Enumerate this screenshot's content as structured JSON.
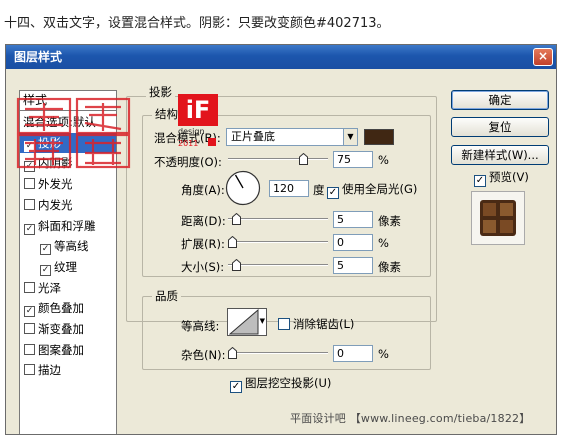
{
  "caption": "十四、双击文字，设置混合样式。阴影：只要改变颜色#402713。",
  "dialog": {
    "title": "图层样式",
    "close": "×"
  },
  "styles_panel": {
    "header": "样式",
    "items": [
      {
        "label": "混合选项:默认",
        "checked": null,
        "sub": false,
        "selected": false
      },
      {
        "label": "投影",
        "checked": true,
        "sub": false,
        "selected": true
      },
      {
        "label": "内阴影",
        "checked": true,
        "sub": false,
        "selected": false
      },
      {
        "label": "外发光",
        "checked": false,
        "sub": false,
        "selected": false
      },
      {
        "label": "内发光",
        "checked": false,
        "sub": false,
        "selected": false
      },
      {
        "label": "斜面和浮雕",
        "checked": true,
        "sub": false,
        "selected": false
      },
      {
        "label": "等高线",
        "checked": true,
        "sub": true,
        "selected": false
      },
      {
        "label": "纹理",
        "checked": true,
        "sub": true,
        "selected": false
      },
      {
        "label": "光泽",
        "checked": false,
        "sub": false,
        "selected": false
      },
      {
        "label": "颜色叠加",
        "checked": true,
        "sub": false,
        "selected": false
      },
      {
        "label": "渐变叠加",
        "checked": false,
        "sub": false,
        "selected": false
      },
      {
        "label": "图案叠加",
        "checked": false,
        "sub": false,
        "selected": false
      },
      {
        "label": "描边",
        "checked": false,
        "sub": false,
        "selected": false
      }
    ]
  },
  "drop_shadow": {
    "group_title": "投影",
    "structure_title": "结构",
    "blend_mode_label": "混合模式(B):",
    "blend_mode_value": "正片叠底",
    "shadow_color": "#402713",
    "opacity_label": "不透明度(O):",
    "opacity_value": "75",
    "opacity_unit": "%",
    "opacity_fraction": 0.75,
    "angle_label": "角度(A):",
    "angle_value": "120",
    "angle_unit": "度",
    "global_light_label": "使用全局光(G)",
    "global_light_checked": true,
    "distance_label": "距离(D):",
    "distance_value": "5",
    "distance_unit": "像素",
    "spread_label": "扩展(R):",
    "spread_value": "0",
    "spread_unit": "%",
    "size_label": "大小(S):",
    "size_value": "5",
    "size_unit": "像素"
  },
  "quality": {
    "group_title": "品质",
    "contour_label": "等高线:",
    "anti_alias_label": "消除锯齿(L)",
    "anti_alias_checked": false,
    "noise_label": "杂色(N):",
    "noise_value": "0",
    "noise_unit": "%",
    "knockout_label": "图层挖空投影(U)",
    "knockout_checked": true
  },
  "buttons": {
    "ok": "确定",
    "reset": "复位",
    "new_style": "新建样式(W)...",
    "preview_label": "预览(V)",
    "preview_checked": true
  },
  "overlay": {
    "stamp_text": "創意無限",
    "logo_letters": "iF",
    "logo_word": "design",
    "logo_year": "2011"
  },
  "watermark": "平面设计吧 【www.lineeg.com/tieba/1822】",
  "colors": {
    "accent_blue": "#316ac5",
    "titlebar": "#1c56ad",
    "dialog_bg": "#ece9d8",
    "stamp_red": "#d9232a",
    "logo_red": "#e2141c"
  }
}
